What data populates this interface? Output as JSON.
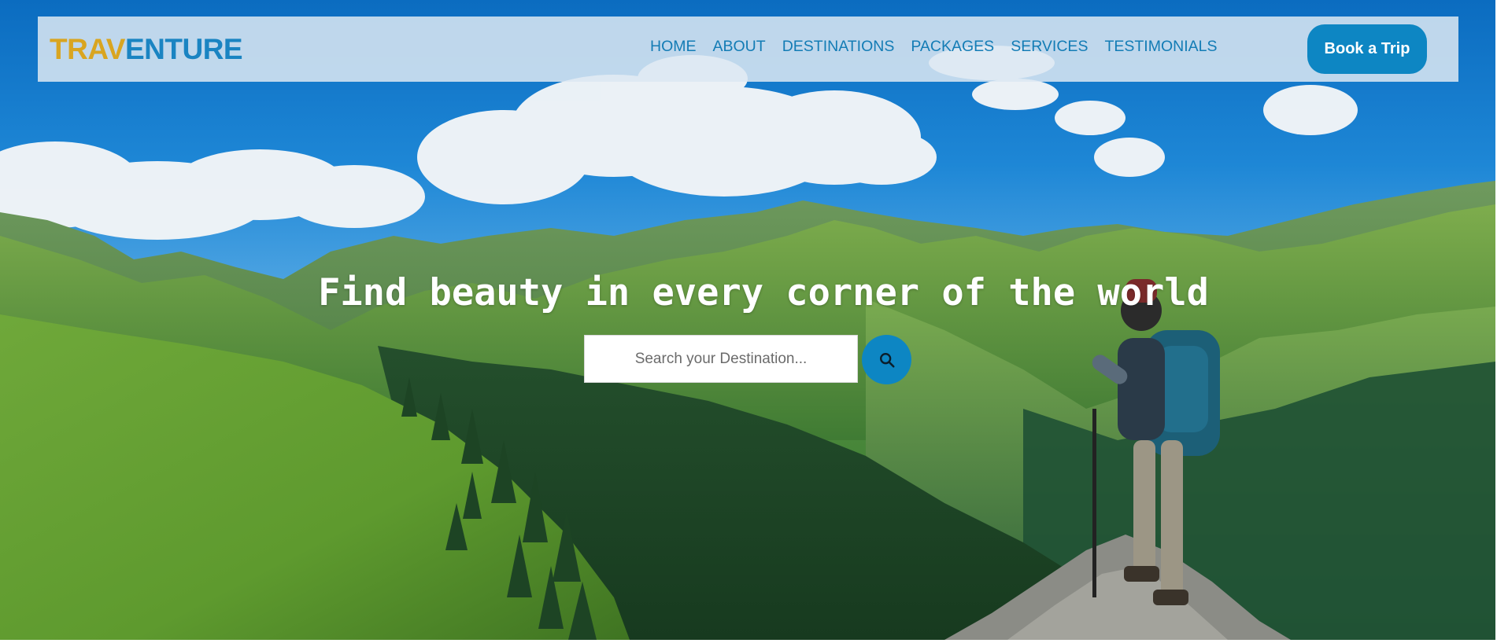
{
  "brand": {
    "logo_part1": "TRAV",
    "logo_part2": "ENTURE",
    "logo_color_part1": "#d9a520",
    "logo_color_part2": "#1a84c2"
  },
  "nav": {
    "items": [
      {
        "label": "HOME"
      },
      {
        "label": "ABOUT"
      },
      {
        "label": "DESTINATIONS"
      },
      {
        "label": "PACKAGES"
      },
      {
        "label": "SERVICES"
      },
      {
        "label": "TESTIMONIALS"
      }
    ],
    "cta_label": "Book a Trip"
  },
  "hero": {
    "headline": "Find beauty in every corner of the world",
    "search_placeholder": "Search your Destination...",
    "search_icon": "search-icon"
  },
  "colors": {
    "accent": "#0d86c3",
    "nav_text": "#137cb5",
    "headline": "#ffffff"
  }
}
